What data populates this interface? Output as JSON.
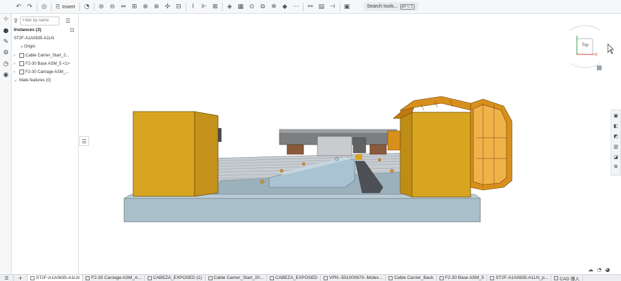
{
  "toolbar": {
    "insert_label": "Insert",
    "search_label": "Search tools...",
    "search_shortcut": "alt/⌥ C",
    "icons": [
      "undo-icon",
      "redo-icon",
      "explode-icon",
      "insert-icon",
      "cut-icon",
      "fastened-mate-icon",
      "revolute-mate-icon",
      "slider-mate-icon",
      "planar-mate-icon",
      "cylindrical-mate-icon",
      "pin-slot-mate-icon",
      "ball-mate-icon",
      "parallel-mate-icon",
      "tangent-mate-icon",
      "width-mate-icon",
      "group-icon",
      "mate-connector-icon",
      "linear-pattern-icon",
      "circular-pattern-icon",
      "replicate-icon",
      "gear-relation-icon",
      "rack-pinion-icon",
      "screw-relation-icon",
      "linear-relation-icon",
      "measure-icon",
      "section-view-icon"
    ]
  },
  "panel": {
    "filter_placeholder": "Filter by name",
    "title": "Instances (3)",
    "items": [
      {
        "label": "ST2F-A1A0835-A1LN",
        "level": 0
      },
      {
        "label": "Origin",
        "level": 1
      },
      {
        "label": "Cable Carrier_Start_2...",
        "level": 0
      },
      {
        "label": "F2-30 Base ASM_5 <1>",
        "level": 0
      },
      {
        "label": "F2-30 Carriage ASM_...",
        "level": 0
      },
      {
        "label": "Mate features (0)",
        "level": 0
      }
    ]
  },
  "view_cube": {
    "label": "Top",
    "axis_x": "X"
  },
  "tabs": [
    {
      "label": "ST2F-A1A0835-A1LN",
      "active": true
    },
    {
      "label": "F2-30 Carriage ASM_A...",
      "active": false
    },
    {
      "label": "CABEZA_EXPOSED (1)",
      "active": false
    },
    {
      "label": "Cable Carrier_Start_20...",
      "active": false
    },
    {
      "label": "CABEZA_EXPOSED",
      "active": false
    },
    {
      "label": "VPN--551000670--Molex...",
      "active": false
    },
    {
      "label": "Cable Carrier_Back",
      "active": false
    },
    {
      "label": "F2-30 Base ASM_5",
      "active": false
    },
    {
      "label": "ST2F-A1A0835-A1LN_p...",
      "active": false
    },
    {
      "label": "CAD 導入",
      "active": false
    }
  ],
  "colors": {
    "body_yellow": "#d7a51f",
    "plate_blue": "#a9c0cb",
    "cable_orange": "#d8901c",
    "rail_gray": "#9aa0a6"
  }
}
